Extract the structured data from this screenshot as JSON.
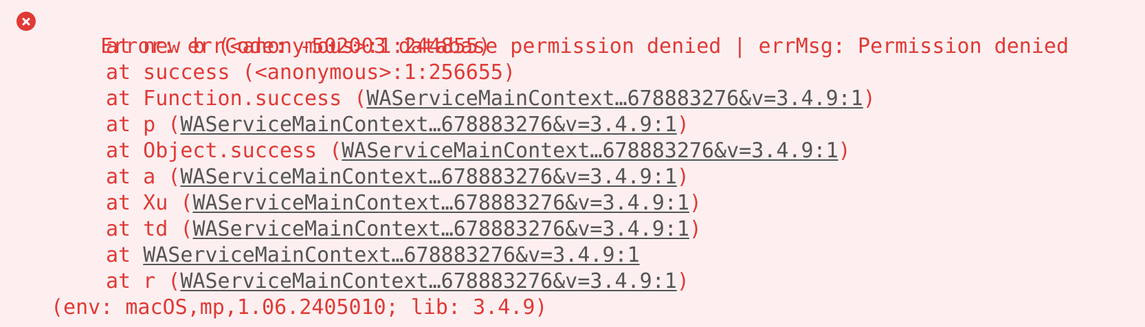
{
  "error": {
    "icon": "error-circle-x-icon",
    "message": "Error: errCode: -502003 database permission denied | errMsg: Permission denied",
    "color": "#e03a36"
  },
  "link_color": "#555555",
  "stack": [
    {
      "prefix": "at new b (<anonymous>:1:244855)",
      "link": "",
      "suffix": ""
    },
    {
      "prefix": "at success (<anonymous>:1:256655)",
      "link": "",
      "suffix": ""
    },
    {
      "prefix": "at Function.success (",
      "link": "WAServiceMainContext…678883276&v=3.4.9:1",
      "suffix": ")"
    },
    {
      "prefix": "at p (",
      "link": "WAServiceMainContext…678883276&v=3.4.9:1",
      "suffix": ")"
    },
    {
      "prefix": "at Object.success (",
      "link": "WAServiceMainContext…678883276&v=3.4.9:1",
      "suffix": ")"
    },
    {
      "prefix": "at a (",
      "link": "WAServiceMainContext…678883276&v=3.4.9:1",
      "suffix": ")"
    },
    {
      "prefix": "at Xu (",
      "link": "WAServiceMainContext…678883276&v=3.4.9:1",
      "suffix": ")"
    },
    {
      "prefix": "at td (",
      "link": "WAServiceMainContext…678883276&v=3.4.9:1",
      "suffix": ")"
    },
    {
      "prefix": "at ",
      "link": "WAServiceMainContext…678883276&v=3.4.9:1",
      "suffix": ""
    },
    {
      "prefix": "at r (",
      "link": "WAServiceMainContext…678883276&v=3.4.9:1",
      "suffix": ")"
    }
  ],
  "env": "(env: macOS,mp,1.06.2405010; lib: 3.4.9)"
}
